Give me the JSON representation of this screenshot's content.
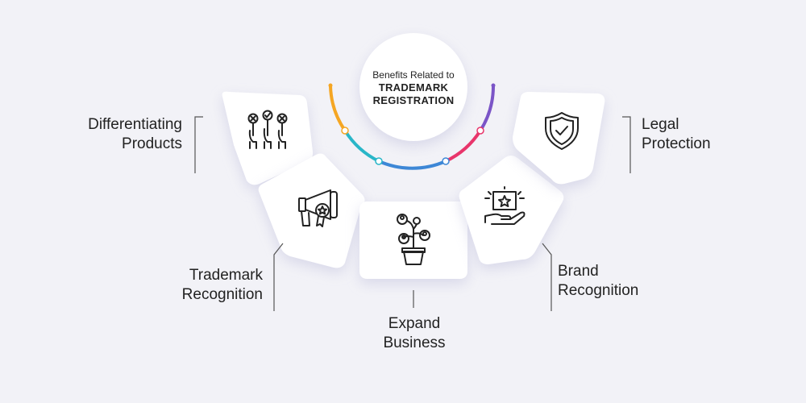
{
  "center": {
    "line1": "Benefits Related to",
    "line2a": "TRADEMARK",
    "line2b": "REGISTRATION"
  },
  "benefits": [
    {
      "line1": "Differentiating",
      "line2": "Products",
      "icon": "voting-hands-icon"
    },
    {
      "line1": "Trademark",
      "line2": "Recognition",
      "icon": "megaphone-badge-icon"
    },
    {
      "line1": "Expand",
      "line2": "Business",
      "icon": "growing-plant-icon"
    },
    {
      "line1": "Brand",
      "line2": "Recognition",
      "icon": "hand-star-icon"
    },
    {
      "line1": "Legal",
      "line2": "Protection",
      "icon": "shield-check-icon"
    }
  ],
  "colors": {
    "background": "#f2f2f7",
    "card": "#ffffff",
    "arc_orange": "#f5a623",
    "arc_teal": "#29b6c8",
    "arc_blue": "#3d87d6",
    "arc_pink": "#e8356b",
    "arc_purple": "#7b55c7"
  }
}
